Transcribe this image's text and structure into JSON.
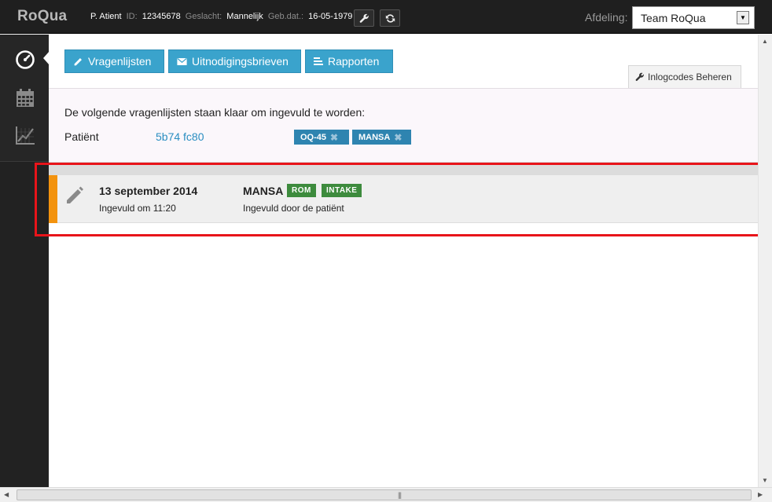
{
  "app": {
    "logo": "RoQua"
  },
  "patient": {
    "name": "P. Atient",
    "id_label": "ID:",
    "id": "12345678",
    "gender_label": "Geslacht:",
    "gender": "Mannelijk",
    "dob_label": "Geb.dat.:",
    "dob": "16-05-1979"
  },
  "header": {
    "afdeling_label": "Afdeling:",
    "afdeling_value": "Team RoQua"
  },
  "toolbar": {
    "vragenlijsten": "Vragenlijsten",
    "uitnodigingsbrieven": "Uitnodigingsbrieven",
    "rapporten": "Rapporten",
    "inlogcodes": "Inlogcodes Beheren"
  },
  "ready": {
    "title": "De volgende vragenlijsten staan klaar om ingevuld te worden:",
    "patient_label": "Patiënt",
    "patient_code": "5b74 fc80",
    "tags": [
      "OQ-45",
      "MANSA"
    ]
  },
  "entry": {
    "date": "13 september 2014",
    "time": "Ingevuld om 11:20",
    "name": "MANSA",
    "tags": [
      "ROM",
      "INTAKE"
    ],
    "by": "Ingevuld door de patiënt"
  },
  "colors": {
    "accent_blue": "#3aa3cc",
    "tag_blue": "#2e84b0",
    "tag_green": "#3d8b3d",
    "entry_accent": "#f3930e",
    "highlight_red": "#e8141a"
  }
}
